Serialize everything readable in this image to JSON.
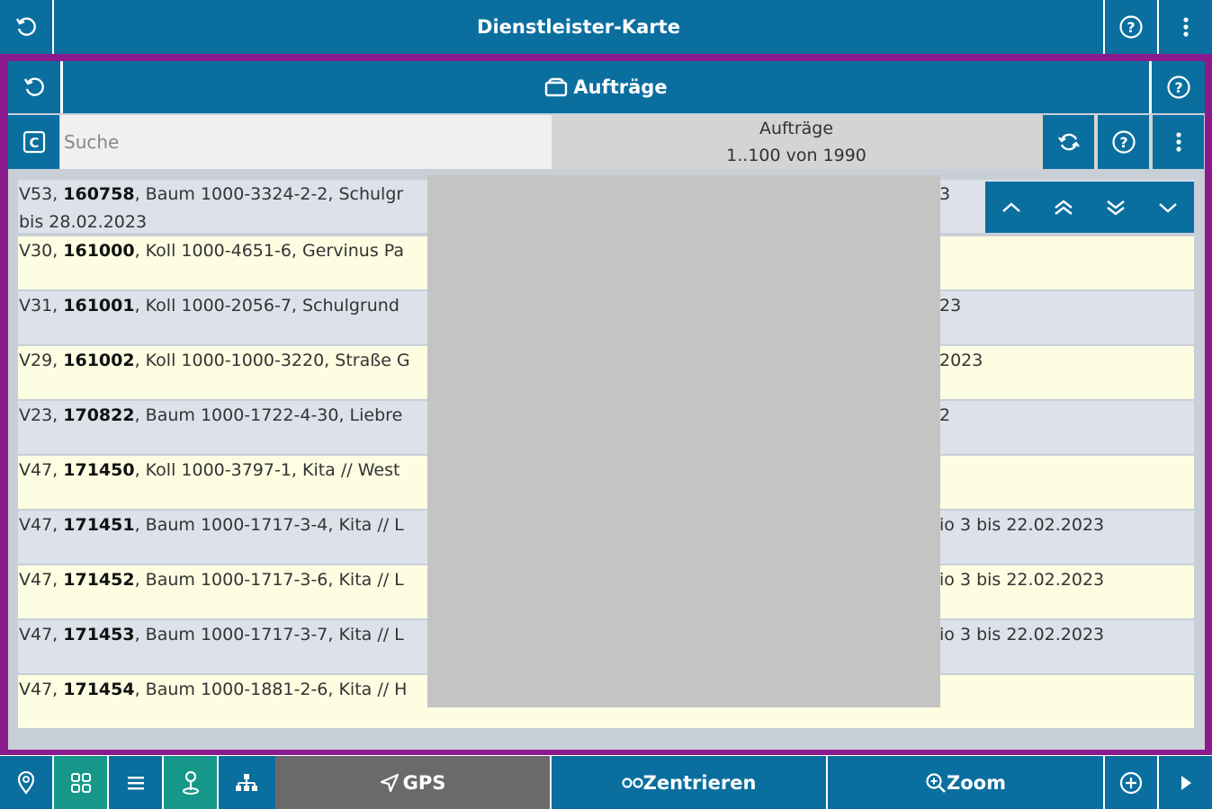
{
  "top_bar": {
    "title": "Dienstleister-Karte"
  },
  "sub_bar": {
    "title": "Aufträge"
  },
  "search": {
    "placeholder": "Suche",
    "value": ""
  },
  "counter": {
    "label": "Aufträge",
    "range": "1..100 von 1990"
  },
  "rows": [
    {
      "left_prefix": "V53, ",
      "id": "160758",
      "left_suffix": ", Baum 1000-3324-2-2, Schulgr",
      "right": "3",
      "line2": "bis 28.02.2023"
    },
    {
      "left_prefix": "V30, ",
      "id": "161000",
      "left_suffix": ", Koll 1000-4651-6, Gervinus Pa",
      "right": "",
      "line2": ""
    },
    {
      "left_prefix": "V31, ",
      "id": "161001",
      "left_suffix": ", Koll 1000-2056-7, Schulgrund",
      "right": "23",
      "line2": ""
    },
    {
      "left_prefix": "V29, ",
      "id": "161002",
      "left_suffix": ", Koll 1000-1000-3220, Straße G",
      "right": "2023",
      "line2": ""
    },
    {
      "left_prefix": "V23, ",
      "id": "170822",
      "left_suffix": ", Baum 1000-1722-4-30, Liebre",
      "right": "2",
      "line2": ""
    },
    {
      "left_prefix": "V47, ",
      "id": "171450",
      "left_suffix": ", Koll 1000-3797-1, Kita // West",
      "right": "",
      "line2": ""
    },
    {
      "left_prefix": "V47, ",
      "id": "171451",
      "left_suffix": ", Baum 1000-1717-3-4, Kita // L",
      "right": "io 3 bis 22.02.2023",
      "line2": ""
    },
    {
      "left_prefix": "V47, ",
      "id": "171452",
      "left_suffix": ", Baum 1000-1717-3-6, Kita // L",
      "right": "io 3 bis 22.02.2023",
      "line2": ""
    },
    {
      "left_prefix": "V47, ",
      "id": "171453",
      "left_suffix": ", Baum 1000-1717-3-7, Kita // L",
      "right": "io 3 bis 22.02.2023",
      "line2": ""
    },
    {
      "left_prefix": "V47, ",
      "id": "171454",
      "left_suffix": ", Baum 1000-1881-2-6, Kita // H",
      "right": "",
      "line2": ""
    }
  ],
  "bottom_bar": {
    "gps_label": "GPS",
    "center_label": "Zentrieren",
    "zoom_label": "Zoom"
  },
  "colors": {
    "primary": "#0a6f9f",
    "frame": "#8b1a8d",
    "active_tab": "#15988a",
    "gps_bg": "#6a6a6a",
    "row_blue": "#dde1ea",
    "row_yellow": "#fdfde2"
  }
}
